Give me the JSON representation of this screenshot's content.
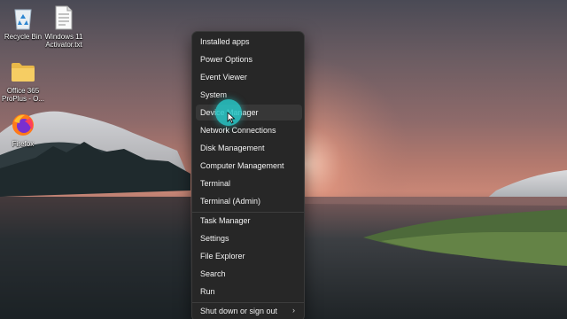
{
  "desktop": {
    "icons": [
      {
        "label": "Recycle Bin",
        "icon": "recycle-bin-icon"
      },
      {
        "label": "Windows 11\nActivator.txt",
        "icon": "text-file-icon"
      },
      {
        "label": "Office 365\nProPlus - O...",
        "icon": "folder-icon"
      },
      {
        "label": "Firefox",
        "icon": "firefox-icon"
      }
    ]
  },
  "context_menu": {
    "items": [
      {
        "label": "Installed apps"
      },
      {
        "label": "Power Options"
      },
      {
        "label": "Event Viewer"
      },
      {
        "label": "System"
      },
      {
        "label": "Device Manager",
        "state": "hovered"
      },
      {
        "label": "Network Connections"
      },
      {
        "label": "Disk Management"
      },
      {
        "label": "Computer Management"
      },
      {
        "label": "Terminal"
      },
      {
        "label": "Terminal (Admin)"
      },
      {
        "label": "Task Manager"
      },
      {
        "label": "Settings"
      },
      {
        "label": "File Explorer"
      },
      {
        "label": "Search"
      },
      {
        "label": "Run"
      },
      {
        "label": "Shut down or sign out",
        "submenu": true
      }
    ],
    "colors": {
      "background": "#272727",
      "hover": "#373737",
      "text": "#f2f2f2"
    }
  },
  "click_indicator": {
    "color": "#28c8c8"
  }
}
